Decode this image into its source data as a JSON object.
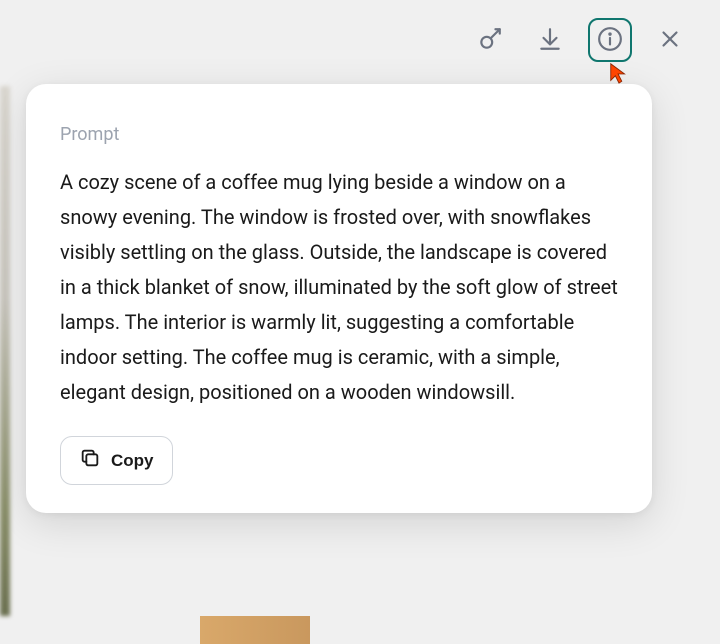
{
  "toolbar": {
    "edit_icon": "edit-brush-icon",
    "download_icon": "download-icon",
    "info_icon": "info-icon",
    "close_icon": "close-icon",
    "active": "info"
  },
  "popover": {
    "label": "Prompt",
    "prompt_text": "A cozy scene of a coffee mug lying beside a window on a snowy evening. The window is frosted over, with snowflakes visibly settling on the glass. Outside, the landscape is covered in a thick blanket of snow, illuminated by the soft glow of street lamps. The interior is warmly lit, suggesting a comfortable indoor setting. The coffee mug is ceramic, with a simple, elegant design, positioned on a wooden windowsill.",
    "copy_label": "Copy"
  }
}
